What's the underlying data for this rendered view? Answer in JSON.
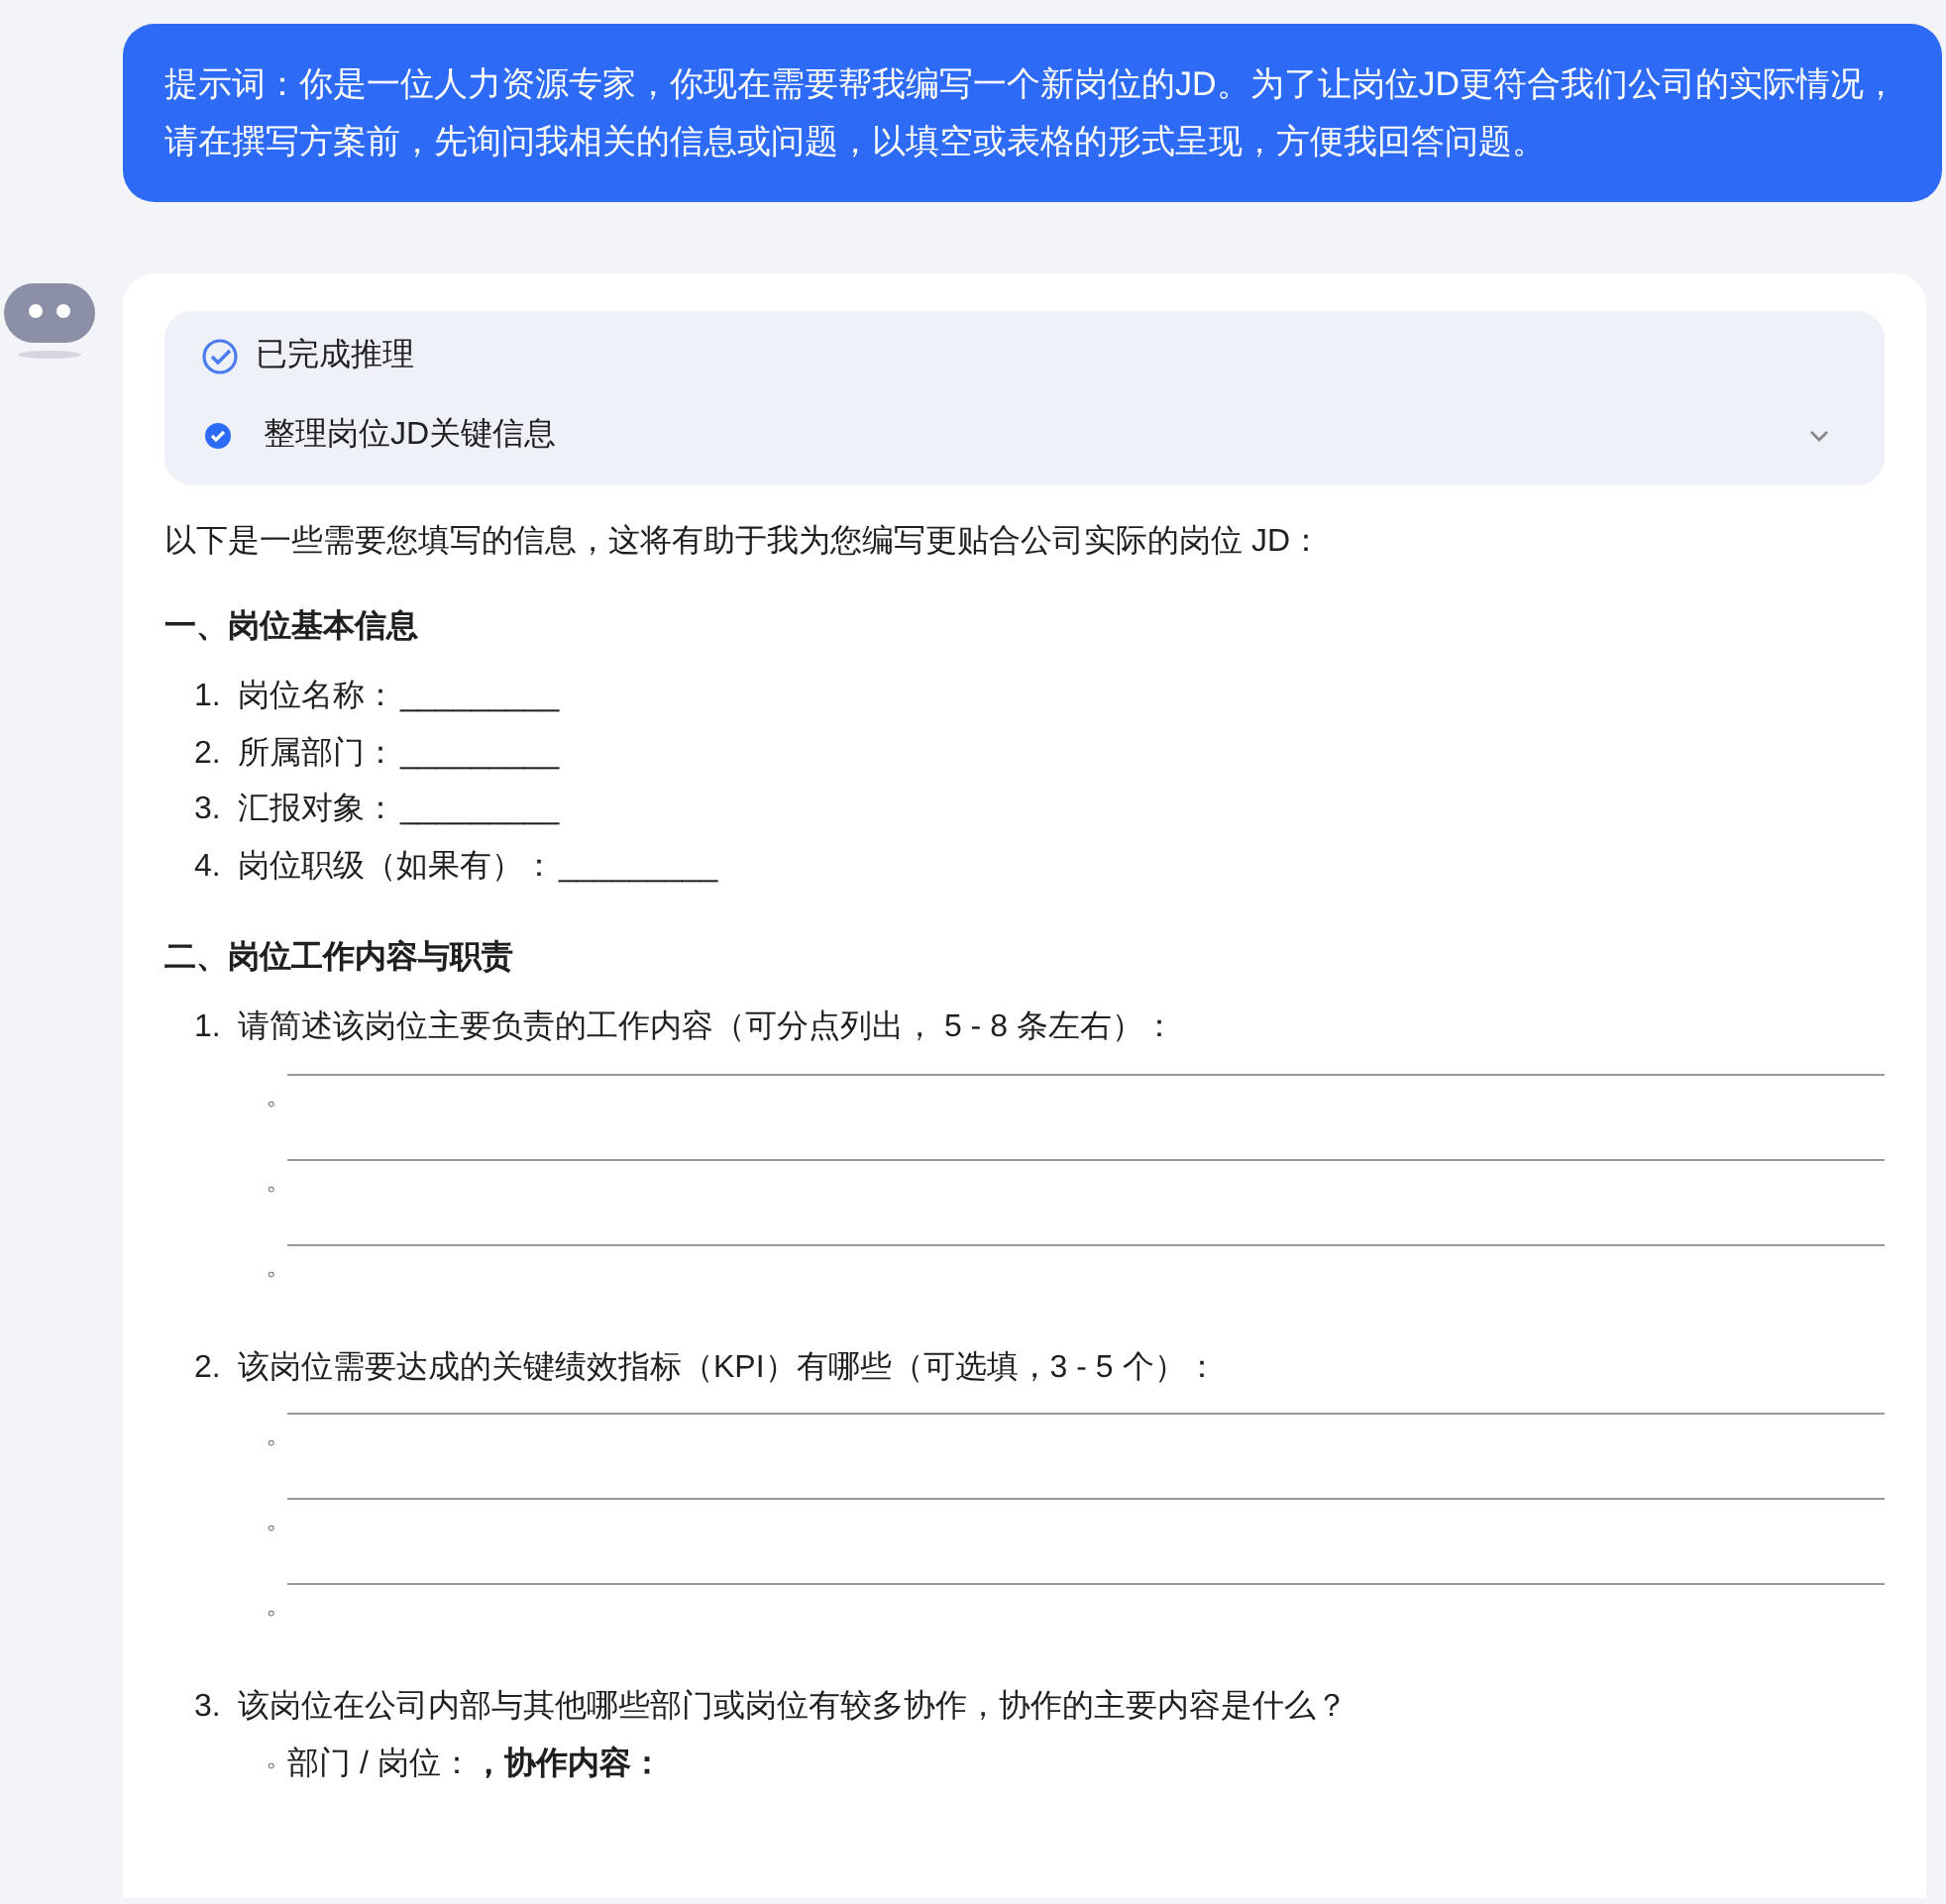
{
  "prompt_bubble": {
    "text": "提示词：你是一位人力资源专家，你现在需要帮我编写一个新岗位的JD。为了让岗位JD更符合我们公司的实际情况，请在撰写方案前，先询问我相关的信息或问题，以填空或表格的形式呈现，方便我回答问题。"
  },
  "reply": {
    "reasoning": {
      "status": "已完成推理",
      "step": "整理岗位JD关键信息",
      "expanded": false
    },
    "intro": "以下是一些需要您填写的信息，这将有助于我为您编写更贴合公司实际的岗位 JD：",
    "sections": [
      {
        "heading": "一、岗位基本信息",
        "items": [
          {
            "number": "1.",
            "text": "岗位名称：",
            "blank": "_________"
          },
          {
            "number": "2.",
            "text": "所属部门：",
            "blank": "_________"
          },
          {
            "number": "3.",
            "text": "汇报对象：",
            "blank": "_________"
          },
          {
            "number": "4.",
            "text": "岗位职级（如果有）：",
            "blank": "_________"
          }
        ]
      },
      {
        "heading": "二、岗位工作内容与职责",
        "items": [
          {
            "number": "1.",
            "text": "请简述该岗位主要负责的工作内容（可分点列出， 5 - 8 条左右）：",
            "bullets": [
              {
                "kind": "blank-line",
                "marker": "◦"
              },
              {
                "kind": "blank-line",
                "marker": "◦"
              },
              {
                "kind": "blank-line",
                "marker": "◦"
              }
            ]
          },
          {
            "number": "2.",
            "text": "该岗位需要达成的关键绩效指标（KPI）有哪些（可选填，3 - 5 个）：",
            "bullets": [
              {
                "kind": "blank-line",
                "marker": "◦"
              },
              {
                "kind": "blank-line",
                "marker": "◦"
              },
              {
                "kind": "blank-line",
                "marker": "◦"
              }
            ]
          },
          {
            "number": "3.",
            "text": "该岗位在公司内部与其他哪些部门或岗位有较多协作，协作的主要内容是什么？",
            "bullets": [
              {
                "kind": "text",
                "marker": "◦",
                "text": "部门 / 岗位：**，协作内容：**"
              }
            ]
          }
        ]
      }
    ]
  }
}
